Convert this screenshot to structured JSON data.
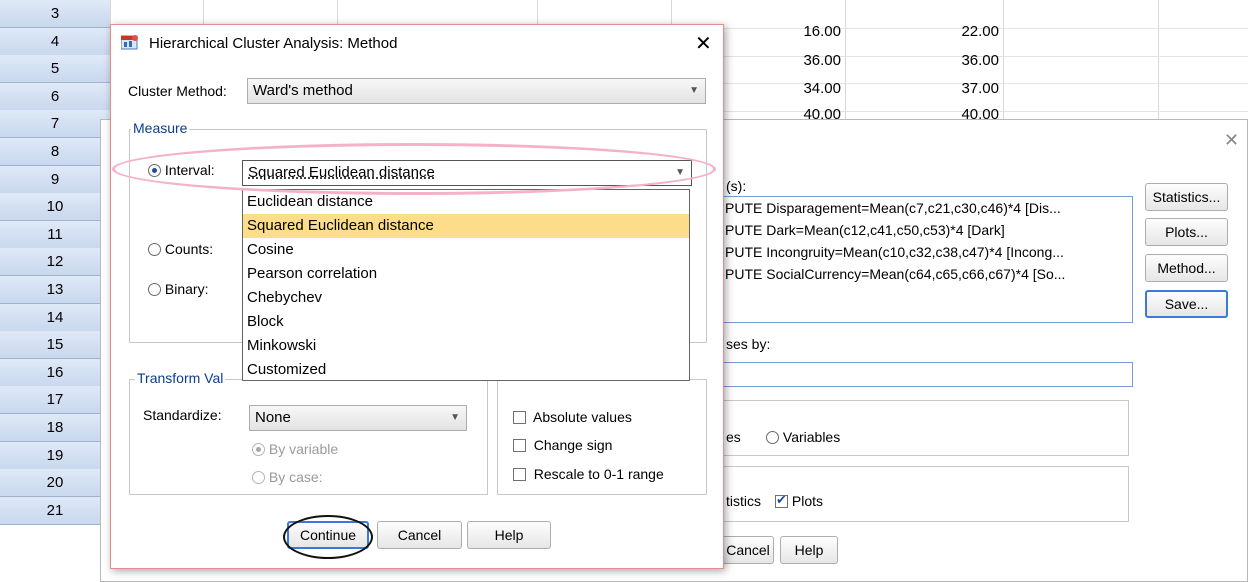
{
  "spreadsheet": {
    "row_numbers": [
      "3",
      "4",
      "5",
      "6",
      "7",
      "8",
      "9",
      "10",
      "11",
      "12",
      "13",
      "14",
      "15",
      "16",
      "17",
      "18",
      "19",
      "20",
      "21"
    ],
    "visible_values": [
      {
        "c1": "16.00",
        "c2": "22.00"
      },
      {
        "c1": "36.00",
        "c2": "36.00"
      },
      {
        "c1": "34.00",
        "c2": "37.00"
      },
      {
        "c1": "40.00",
        "c2": "40.00"
      }
    ]
  },
  "background_dialog": {
    "variables_label_partial": "(s):",
    "variables": [
      "PUTE Disparagement=Mean(c7,c21,c30,c46)*4 [Dis...",
      "PUTE Dark=Mean(c12,c41,c50,c53)*4 [Dark]",
      "PUTE Incongruity=Mean(c10,c32,c38,c47)*4 [Incong...",
      "PUTE SocialCurrency=Mean(c64,c65,c66,c67)*4 [So..."
    ],
    "label_cases_partial": "ses by:",
    "cluster_cases_partial": "es",
    "cluster_variables": "Variables",
    "display_statistics_partial": "tistics",
    "display_plots": "Plots",
    "buttons": {
      "statistics": "Statistics...",
      "plots": "Plots...",
      "method": "Method...",
      "save": "Save...",
      "cancel": "Cancel",
      "help": "Help"
    }
  },
  "dialog": {
    "title": "Hierarchical Cluster Analysis: Method",
    "close_glyph": "✕",
    "cluster_method_label": "Cluster Method:",
    "cluster_method_value": "Ward's method",
    "measure_title": "Measure",
    "interval_label": "Interval:",
    "interval_value": "Squared Euclidean distance",
    "counts_label": "Counts:",
    "binary_label": "Binary:",
    "interval_options": [
      "Euclidean distance",
      "Squared Euclidean distance",
      "Cosine",
      "Pearson correlation",
      "Chebychev",
      "Block",
      "Minkowski",
      "Customized"
    ],
    "selected_option_index": 1,
    "transform_values_title_partial": "Transform Val",
    "standardize_label": "Standardize:",
    "standardize_value": "None",
    "by_variable": "By variable",
    "by_case": "By case:",
    "transform_measures": {
      "absolute_values": "Absolute values",
      "change_sign": "Change sign",
      "rescale": "Rescale to 0-1 range"
    },
    "buttons": {
      "continue": "Continue",
      "cancel": "Cancel",
      "help": "Help"
    }
  }
}
